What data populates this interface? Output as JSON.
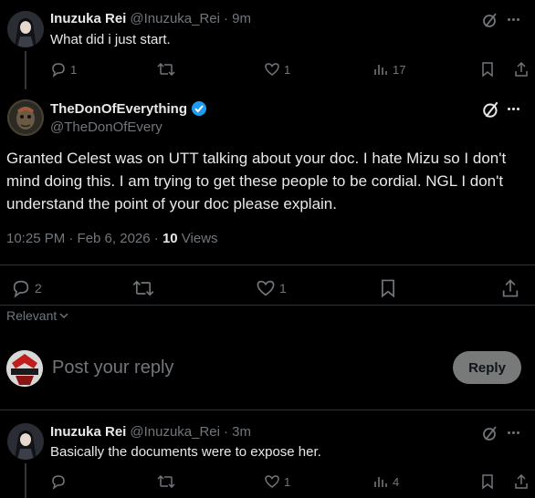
{
  "reply_top": {
    "name": "Inuzuka Rei",
    "handle": "@Inuzuka_Rei",
    "time": "· 9m",
    "text": "What did i just start.",
    "replies": "1",
    "likes": "1",
    "views": "17"
  },
  "main_tweet": {
    "name": "TheDonOfEverything",
    "handle": "@TheDonOfEvery",
    "text": "Granted Celest was on UTT talking about your doc. I hate Mizu so I don't mind doing this. I am trying to get these people to be cordial. NGL I don't understand the point of your doc please explain.",
    "timestamp": "10:25 PM · Feb 6, 2026 · ",
    "views_count": "10",
    "views_label": " Views",
    "replies": "2",
    "likes": "1"
  },
  "sort": {
    "label": "Relevant"
  },
  "composer": {
    "placeholder": "Post your reply",
    "reply_button": "Reply"
  },
  "reply_bottom": {
    "name": "Inuzuka Rei",
    "handle": "@Inuzuka_Rei",
    "time": "· 3m",
    "text": "Basically the documents were to expose her.",
    "likes": "1",
    "views": "4"
  },
  "colors": {
    "background": "#000000",
    "text": "#e7e9ea",
    "muted": "#71767b",
    "verified": "#1d9bf0",
    "reply_button_bg": "#787a7a"
  }
}
